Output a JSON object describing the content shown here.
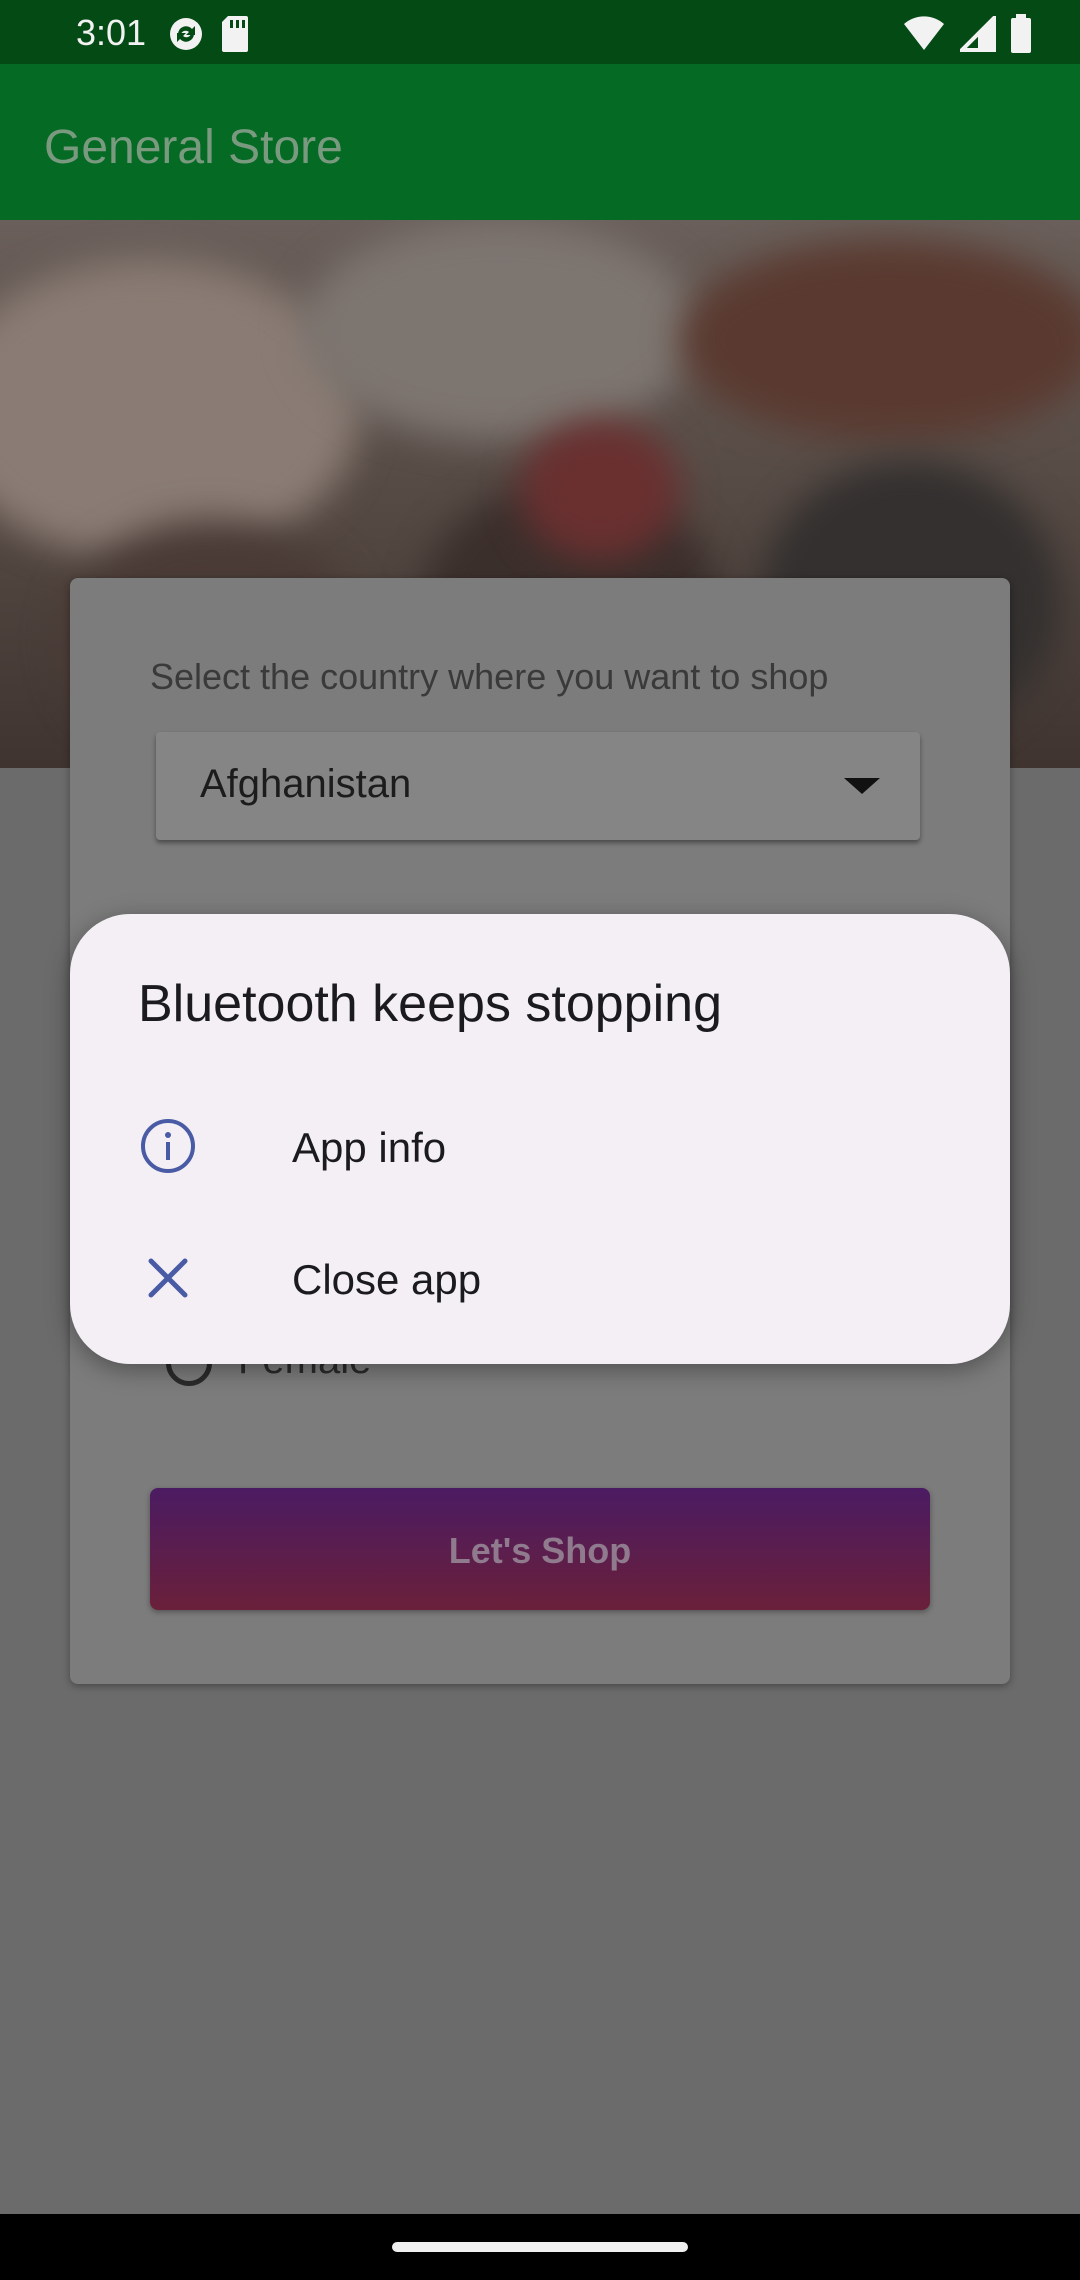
{
  "status_bar": {
    "time": "3:01",
    "left_icons": [
      "sync-icon",
      "sd-card-icon"
    ],
    "right_icons": [
      "wifi-icon",
      "cell-signal-icon",
      "battery-icon"
    ]
  },
  "app_bar": {
    "title": "General Store"
  },
  "form": {
    "prompt": "Select the country where you want to shop",
    "country_value": "Afghanistan",
    "gender_option": "Female",
    "shop_button": "Let's  Shop"
  },
  "dialog": {
    "title": "Bluetooth keeps stopping",
    "options": [
      {
        "label": "App info",
        "icon": "info-icon"
      },
      {
        "label": "Close app",
        "icon": "close-icon"
      }
    ]
  },
  "colors": {
    "status_bar": "#034a14",
    "app_bar": "#056a23",
    "dialog_bg": "#f3eff4",
    "icon_accent": "#4a5ba6",
    "scrim": "#6b6b6b"
  }
}
